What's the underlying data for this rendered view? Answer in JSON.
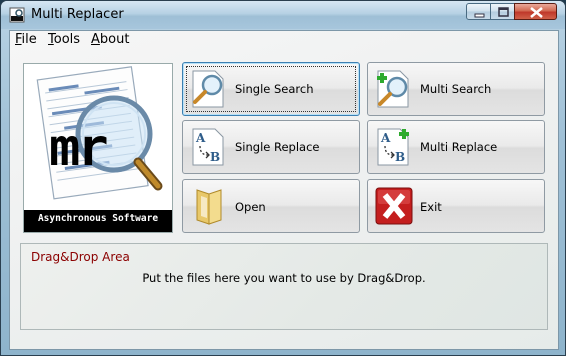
{
  "window": {
    "title": "Multi Replacer"
  },
  "menu": [
    {
      "accel": "F",
      "rest": "ile"
    },
    {
      "accel": "T",
      "rest": "ools"
    },
    {
      "accel": "A",
      "rest": "bout"
    }
  ],
  "logo": {
    "text": "mr",
    "caption": "Asynchronous Software"
  },
  "buttons": {
    "single_search": "Single Search",
    "multi_search": "Multi Search",
    "single_replace": "Single Replace",
    "multi_replace": "Multi Replace",
    "open": "Open",
    "exit": "Exit"
  },
  "dropzone": {
    "title": "Drag&Drop Area",
    "hint": "Put the files here you want to use by Drag&Drop."
  }
}
